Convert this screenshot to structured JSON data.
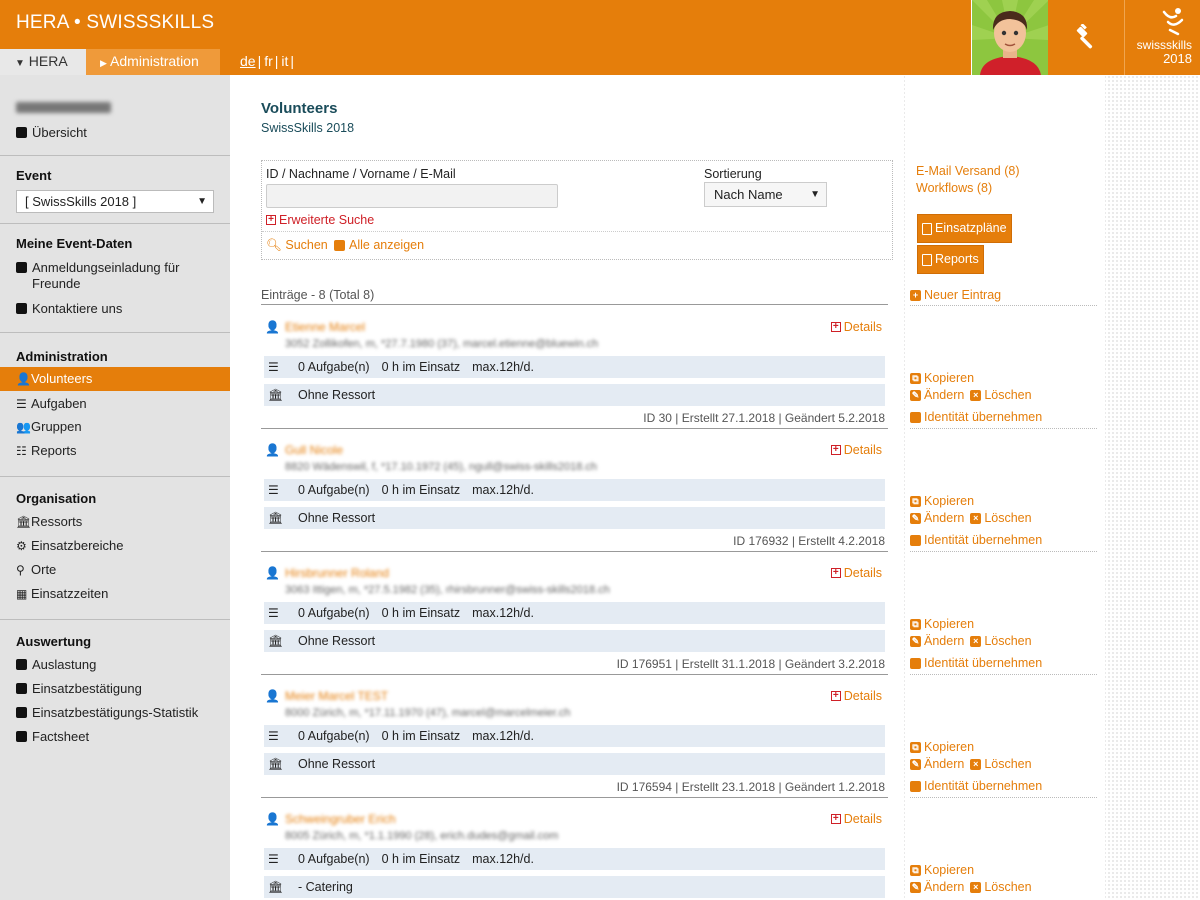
{
  "header": {
    "title": "HERA • SWISSSKILLS",
    "nav_hera": "HERA",
    "nav_admin": "Administration",
    "languages": [
      "de",
      "fr",
      "it"
    ],
    "brand_word": "swissskills",
    "brand_year": "2018"
  },
  "sidebar": {
    "user_label": "Übersicht",
    "event_heading": "Event",
    "event_selected": "[ SwissSkills 2018 ]",
    "my_data_heading": "Meine Event-Daten",
    "my_data_items": [
      "Anmeldungseinladung für Freunde",
      "Kontaktiere uns"
    ],
    "admin_heading": "Administration",
    "admin_items": [
      "Volunteers",
      "Aufgaben",
      "Gruppen",
      "Reports"
    ],
    "org_heading": "Organisation",
    "org_items": [
      "Ressorts",
      "Einsatzbereiche",
      "Orte",
      "Einsatzzeiten"
    ],
    "eval_heading": "Auswertung",
    "eval_items": [
      "Auslastung",
      "Einsatzbestätigung",
      "Einsatzbestätigungs-Statistik",
      "Factsheet"
    ]
  },
  "main": {
    "title": "Volunteers",
    "subtitle": "SwissSkills 2018",
    "search": {
      "label": "ID / Nachname / Vorname / E-Mail",
      "value": "",
      "sort_label": "Sortierung",
      "sort_value": "Nach Name",
      "advanced": "Erweiterte Suche",
      "search_btn": "Suchen",
      "show_all": "Alle anzeigen"
    },
    "entries_count": "Einträge - 8 (Total 8)",
    "entries": [
      {
        "name": "Etienne Marcel",
        "addr": "3052 Zollikofen, m, *27.7.1980 (37), marcel.etienne@bluewin.ch",
        "tasks": "0 Aufgabe(n)",
        "hours": "0 h im Einsatz",
        "max": "max.12h/d.",
        "ressort": "Ohne Ressort",
        "meta": "ID 30 | Erstellt 27.1.2018 | Geändert 5.2.2018",
        "details": "Details"
      },
      {
        "name": "Gull Nicole",
        "addr": "8820 Wädenswil, f, *17.10.1972 (45), ngull@swiss-skills2018.ch",
        "tasks": "0 Aufgabe(n)",
        "hours": "0 h im Einsatz",
        "max": "max.12h/d.",
        "ressort": "Ohne Ressort",
        "meta": "ID 176932 | Erstellt 4.2.2018",
        "details": "Details"
      },
      {
        "name": "Hirsbrunner Roland",
        "addr": "3063 Ittigen, m, *27.5.1982 (35), rhirsbrunner@swiss-skills2018.ch",
        "tasks": "0 Aufgabe(n)",
        "hours": "0 h im Einsatz",
        "max": "max.12h/d.",
        "ressort": "Ohne Ressort",
        "meta": "ID 176951 | Erstellt 31.1.2018 | Geändert 3.2.2018",
        "details": "Details"
      },
      {
        "name": "Meier Marcel TEST",
        "addr": "8000 Zürich, m, *17.11.1970 (47), marcel@marcelmeier.ch",
        "tasks": "0 Aufgabe(n)",
        "hours": "0 h im Einsatz",
        "max": "max.12h/d.",
        "ressort": "Ohne Ressort",
        "meta": "ID 176594 | Erstellt 23.1.2018 | Geändert 1.2.2018",
        "details": "Details"
      },
      {
        "name": "Schweingruber Erich",
        "addr": "8005 Zürich, m, *1.1.1990 (28), erich.dudes@gmail.com",
        "tasks": "0 Aufgabe(n)",
        "hours": "0 h im Einsatz",
        "max": "max.12h/d.",
        "ressort": "- Catering",
        "meta": "",
        "details": "Details"
      }
    ]
  },
  "right": {
    "email_versand": "E-Mail Versand (8)",
    "workflows": "Workflows (8)",
    "einsatzplaene": "Einsatzpläne",
    "reports": "Reports",
    "new_entry": "Neuer Eintrag",
    "copy": "Kopieren",
    "edit": "Ändern",
    "delete": "Löschen",
    "impersonate": "Identität übernehmen"
  },
  "colors": {
    "accent": "#e57e0b",
    "sidebar": "#e3e3e3",
    "row": "#e4ebf3",
    "title": "#1a4c5a",
    "danger": "#cf2027"
  }
}
